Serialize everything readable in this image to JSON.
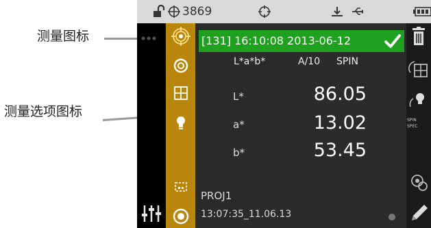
{
  "annotations": {
    "measure_icon": "测量图标",
    "measure_options_icon": "测量选项图标"
  },
  "status": {
    "counter": "3869"
  },
  "header": {
    "text": "[131] 16:10:08 2013-06-12"
  },
  "mode": {
    "space": "L*a*b*",
    "illuminant": "A/10",
    "spin": "SPIN"
  },
  "readings": [
    {
      "label": "L*",
      "value": "86.05"
    },
    {
      "label": "a*",
      "value": "13.02"
    },
    {
      "label": "b*",
      "value": "53.45"
    }
  ],
  "footer": {
    "project": "PROJ1",
    "timestamp": "13:07:35_11.06.13"
  },
  "right_bar": {
    "spin_label": "SPIN",
    "spec_label": "SPEC"
  },
  "colors": {
    "accent": "#b8860b",
    "header_green": "#1fa01f",
    "screen_bg": "#2b2b2b"
  }
}
